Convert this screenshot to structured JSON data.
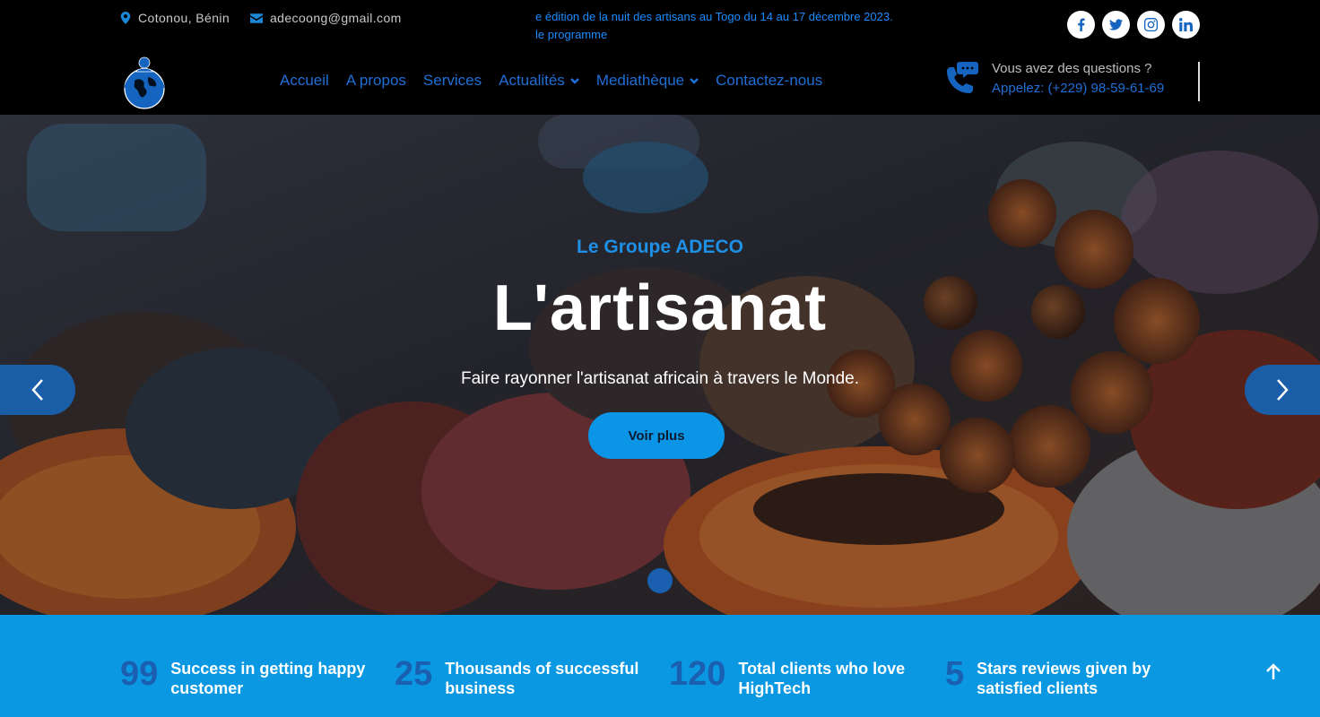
{
  "topbar": {
    "location": "Cotonou, Bénin",
    "email": "adecoong@gmail.com",
    "announcement_line1": "e édition de la nuit des artisans au Togo du 14 au 17 décembre 2023.",
    "announcement_line2": "le programme",
    "socials": [
      "facebook",
      "twitter",
      "instagram",
      "linkedin"
    ]
  },
  "nav": {
    "items": [
      {
        "label": "Accueil"
      },
      {
        "label": "A propos"
      },
      {
        "label": "Services"
      },
      {
        "label": "Actualités",
        "dropdown": true
      },
      {
        "label": "Mediathèque",
        "dropdown": true
      },
      {
        "label": "Contactez-nous"
      }
    ]
  },
  "help": {
    "question": "Vous avez des questions ?",
    "phone": "Appelez: (+229) 98-59-61-69"
  },
  "hero": {
    "subtitle": "Le Groupe ADECO",
    "title": "L'artisanat",
    "description": "Faire rayonner l'artisanat africain à travers le Monde.",
    "button": "Voir plus"
  },
  "stats": [
    {
      "number": "99",
      "label_line1": "Success in getting happy",
      "label_line2": "customer"
    },
    {
      "number": "25",
      "label_line1": "Thousands of successful",
      "label_line2": "business"
    },
    {
      "number": "120",
      "label_line1": "Total clients who love",
      "label_line2": "HighTech"
    },
    {
      "number": "5",
      "label_line1": "Stars reviews given by",
      "label_line2": "satisfied clients"
    }
  ],
  "colors": {
    "accent": "#0a98e2",
    "nav_link": "#1f6fd6",
    "dark_blue": "#1a5fb0"
  }
}
